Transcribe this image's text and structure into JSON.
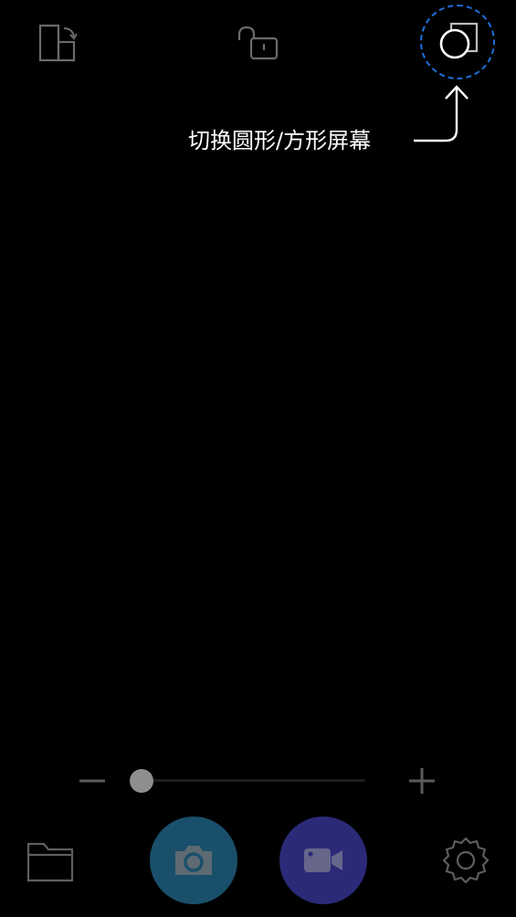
{
  "top_bar": {
    "rotate_icon": "screen-rotate-icon",
    "lock_icon": "unlock-icon",
    "shape_icon": "shape-toggle-icon"
  },
  "tooltip": {
    "text": "切换圆形/方形屏幕",
    "highlight_color": "#1e6fd9"
  },
  "zoom": {
    "value": 0.0,
    "minus_icon": "zoom-out-icon",
    "plus_icon": "zoom-in-icon"
  },
  "bottom_bar": {
    "gallery_icon": "folder-icon",
    "photo_icon": "camera-icon",
    "video_icon": "video-camera-icon",
    "settings_icon": "gear-icon",
    "photo_color": "#1a4f6b",
    "video_color": "#2b2a78"
  }
}
